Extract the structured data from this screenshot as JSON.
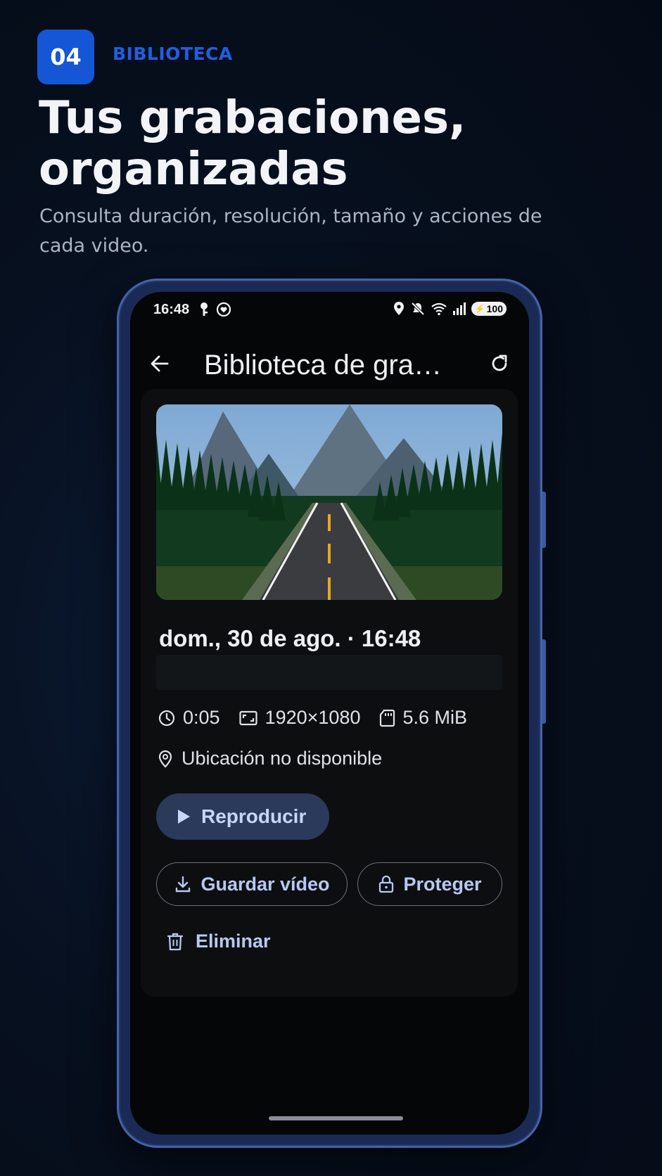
{
  "promo": {
    "step_number": "04",
    "step_label": "BIBLIOTECA",
    "headline": "Tus grabaciones, organizadas",
    "subtitle": "Consulta duración, resolución, tamaño y acciones de cada video."
  },
  "statusbar": {
    "time": "16:48",
    "battery": "100",
    "icons_left": [
      "key-icon",
      "heart-circle-icon"
    ],
    "icons_right": [
      "location-icon",
      "mute-icon",
      "wifi-icon",
      "signal-icon",
      "battery-icon"
    ]
  },
  "appbar": {
    "title": "Biblioteca de grabaciones",
    "back_icon": "arrow-left-icon",
    "refresh_icon": "refresh-icon"
  },
  "recording": {
    "date_time": "dom., 30 de ago. · 16:48",
    "duration": "0:05",
    "resolution": "1920×1080",
    "size": "5.6 MiB",
    "location": "Ubicación no disponible"
  },
  "actions": {
    "play": "Reproducir",
    "save": "Guardar vídeo",
    "protect": "Proteger",
    "delete": "Eliminar"
  },
  "colors": {
    "accent": "#1556d6",
    "button_text": "#b8c8f2",
    "play_bg": "#2b3a5a"
  }
}
